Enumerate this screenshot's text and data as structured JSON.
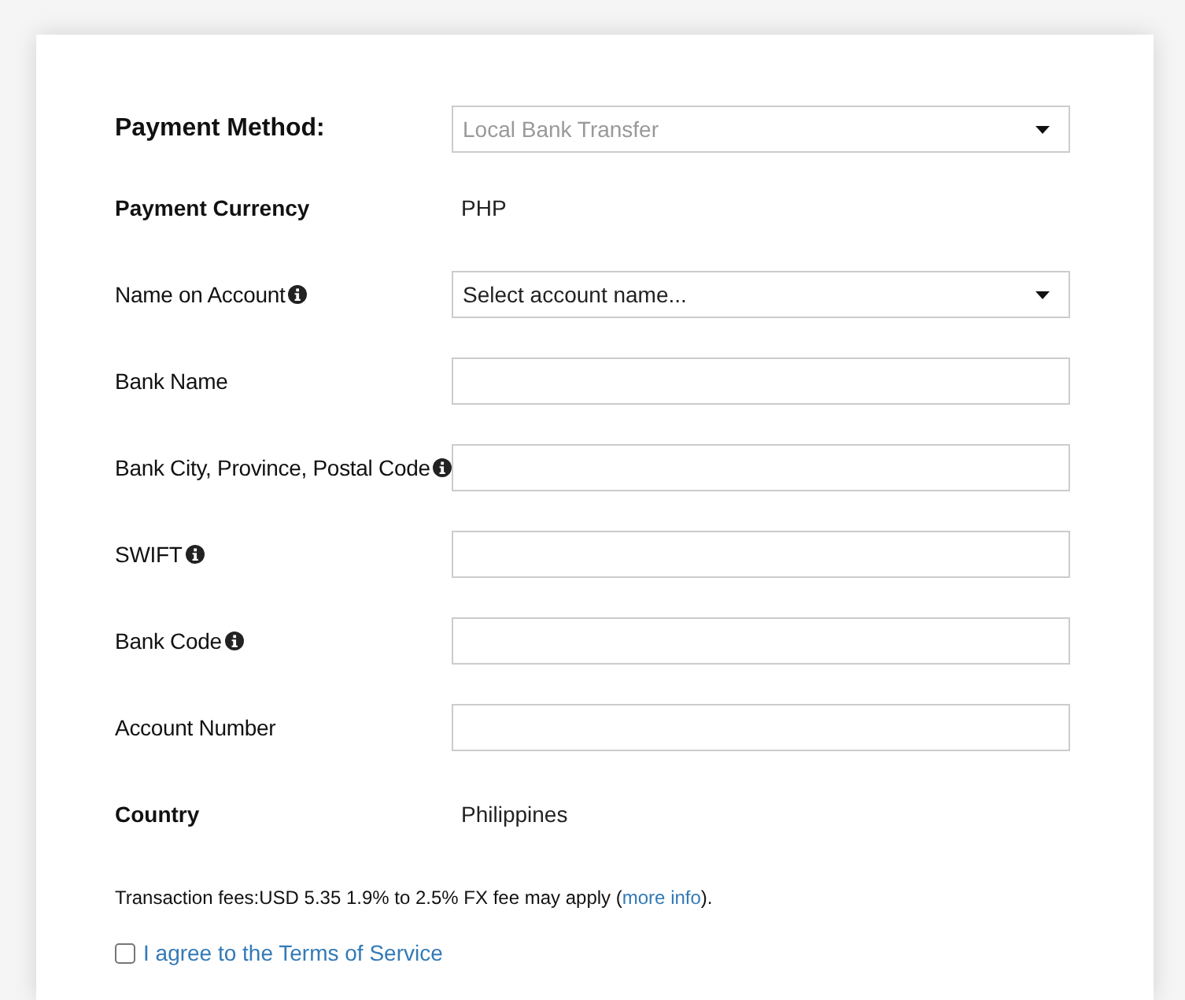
{
  "payment_method": {
    "label": "Payment Method:",
    "value": "Local Bank Transfer",
    "disabled": true
  },
  "fields": [
    {
      "kind": "static",
      "label": "Payment Currency",
      "value": "PHP"
    },
    {
      "kind": "select",
      "label": "Name on Account",
      "info": true,
      "value": "Select account name..."
    },
    {
      "kind": "input",
      "label": "Bank Name",
      "info": false
    },
    {
      "kind": "input",
      "label": "Bank City, Province, Postal Code",
      "info": true
    },
    {
      "kind": "input",
      "label": "SWIFT",
      "info": true
    },
    {
      "kind": "input",
      "label": "Bank Code",
      "info": true
    },
    {
      "kind": "input",
      "label": "Account Number",
      "info": false
    },
    {
      "kind": "static",
      "label": "Country",
      "value": "Philippines"
    }
  ],
  "fees": {
    "text": "Transaction fees:USD 5.35 1.9% to 2.5% FX fee may apply (",
    "link": "more info",
    "after": ")."
  },
  "agreement": {
    "label": "I agree to the Terms of Service",
    "checked": false
  }
}
